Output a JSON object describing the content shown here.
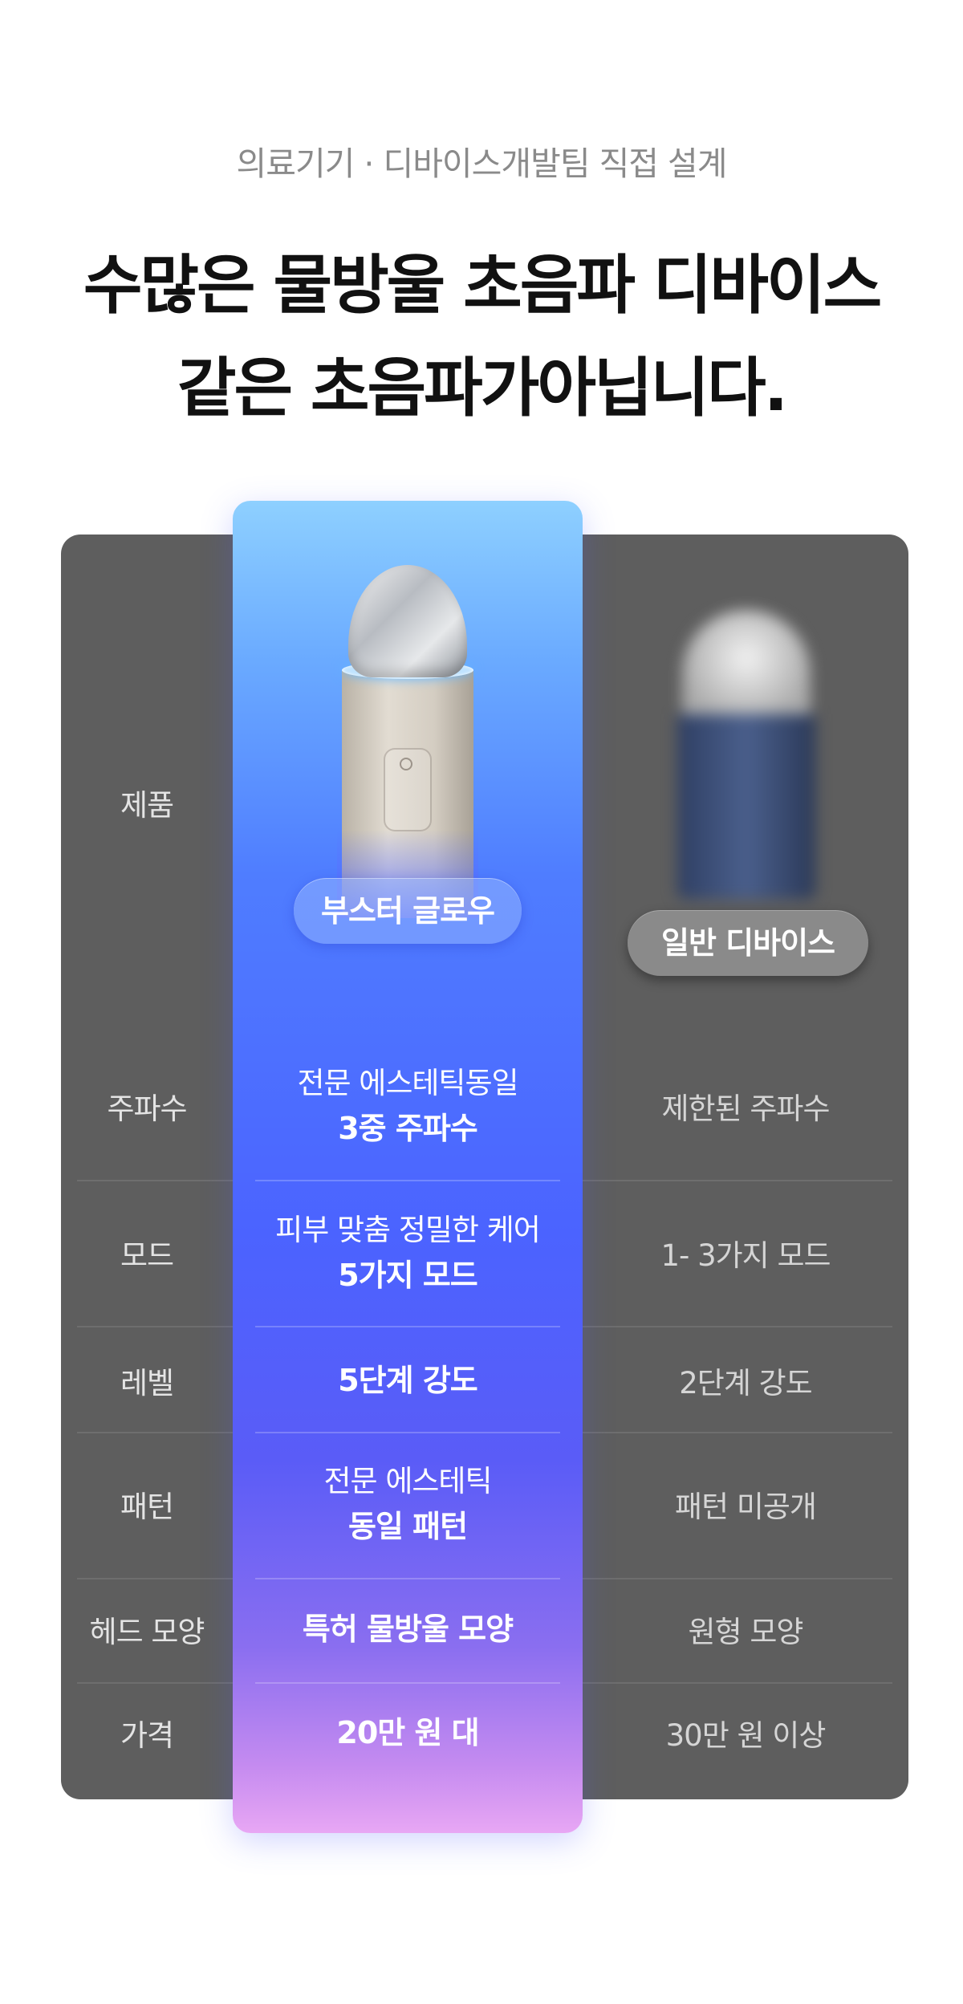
{
  "header": {
    "subtitle": "의료기기 · 디바이스개발팀 직접 설계",
    "headline_line1": "수많은 물방울 초음파 디바이스",
    "headline_line2": "같은 초음파가아닙니다."
  },
  "comparison": {
    "product_row_label": "제품",
    "featured_name": "부스터 글로우",
    "other_name": "일반 디바이스",
    "rows": [
      {
        "label": "주파수",
        "featured_light": "전문 에스테틱동일",
        "featured_bold": "3중 주파수",
        "other": "제한된 주파수"
      },
      {
        "label": "모드",
        "featured_light": "피부 맞춤 정밀한 케어",
        "featured_bold": "5가지 모드",
        "other": "1- 3가지 모드"
      },
      {
        "label": "레벨",
        "featured_light": "",
        "featured_bold": "5단계 강도",
        "other": "2단계 강도"
      },
      {
        "label": "패턴",
        "featured_light": "전문 에스테틱",
        "featured_bold": "동일 패턴",
        "other": "패턴 미공개"
      },
      {
        "label": "헤드 모양",
        "featured_light": "",
        "featured_bold": "특허 물방울 모양",
        "other": "원형 모양"
      },
      {
        "label": "가격",
        "featured_light": "",
        "featured_bold": "20만 원 대",
        "other": "30만 원 이상"
      }
    ]
  },
  "colors": {
    "board": "#5e5e5e",
    "featured_top": "#8ed0ff",
    "featured_mid": "#4b63ff",
    "featured_bottom": "#e8a7f4"
  }
}
